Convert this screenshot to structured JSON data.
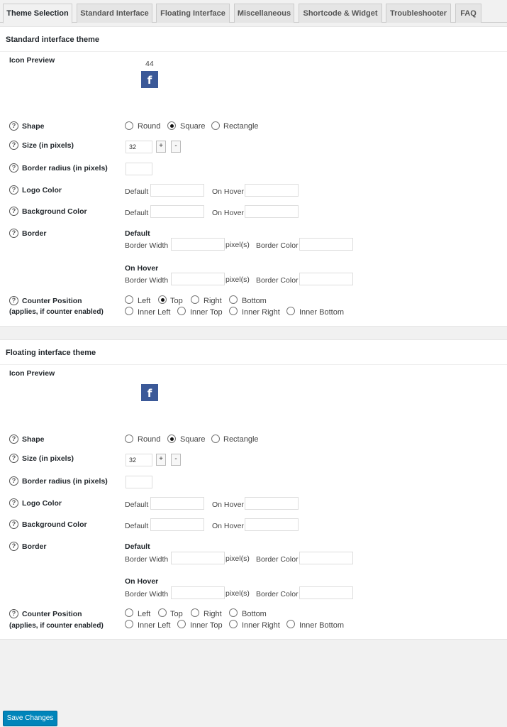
{
  "tabs": [
    {
      "label": "Theme Selection",
      "active": true
    },
    {
      "label": "Standard Interface",
      "active": false
    },
    {
      "label": "Floating Interface",
      "active": false
    },
    {
      "label": "Miscellaneous",
      "active": false
    },
    {
      "label": "Shortcode & Widget",
      "active": false
    },
    {
      "label": "Troubleshooter",
      "active": false
    },
    {
      "label": "FAQ",
      "active": false
    }
  ],
  "standard": {
    "title": "Standard interface theme",
    "icon_preview_label": "Icon Preview",
    "counter_value": "44",
    "facebook_glyph": "f",
    "shape": {
      "label": "Shape",
      "options": [
        "Round",
        "Square",
        "Rectangle"
      ],
      "selected": "Square"
    },
    "size": {
      "label": "Size (in pixels)",
      "value": "32",
      "plus": "+",
      "minus": "-"
    },
    "border_radius": {
      "label": "Border radius (in pixels)",
      "value": ""
    },
    "logo_color": {
      "label": "Logo Color",
      "default_label": "Default",
      "hover_label": "On Hover",
      "default_value": "",
      "hover_value": ""
    },
    "background_color": {
      "label": "Background Color",
      "default_label": "Default",
      "hover_label": "On Hover",
      "default_value": "",
      "hover_value": ""
    },
    "border": {
      "label": "Border",
      "default_heading": "Default",
      "hover_heading": "On Hover",
      "width_label": "Border Width",
      "unit": "pixel(s)",
      "color_label": "Border Color"
    },
    "counter_position": {
      "label": "Counter Position",
      "sublabel": "(applies, if counter enabled)",
      "options": [
        "Left",
        "Top",
        "Right",
        "Bottom",
        "Inner Left",
        "Inner Top",
        "Inner Right",
        "Inner Bottom"
      ],
      "selected": "Top"
    }
  },
  "floating": {
    "title": "Floating interface theme",
    "icon_preview_label": "Icon Preview",
    "facebook_glyph": "f",
    "shape": {
      "label": "Shape",
      "options": [
        "Round",
        "Square",
        "Rectangle"
      ],
      "selected": "Square"
    },
    "size": {
      "label": "Size (in pixels)",
      "value": "32",
      "plus": "+",
      "minus": "-"
    },
    "border_radius": {
      "label": "Border radius (in pixels)",
      "value": ""
    },
    "logo_color": {
      "label": "Logo Color",
      "default_label": "Default",
      "hover_label": "On Hover",
      "default_value": "",
      "hover_value": ""
    },
    "background_color": {
      "label": "Background Color",
      "default_label": "Default",
      "hover_label": "On Hover",
      "default_value": "",
      "hover_value": ""
    },
    "border": {
      "label": "Border",
      "default_heading": "Default",
      "hover_heading": "On Hover",
      "width_label": "Border Width",
      "unit": "pixel(s)",
      "color_label": "Border Color"
    },
    "counter_position": {
      "label": "Counter Position",
      "sublabel": "(applies, if counter enabled)",
      "options": [
        "Left",
        "Top",
        "Right",
        "Bottom",
        "Inner Left",
        "Inner Top",
        "Inner Right",
        "Inner Bottom"
      ],
      "selected": "None"
    }
  },
  "help_icon_glyph": "?",
  "save_button": "Save Changes",
  "colors": {
    "accent": "#0085ba",
    "facebook": "#3b5998"
  }
}
